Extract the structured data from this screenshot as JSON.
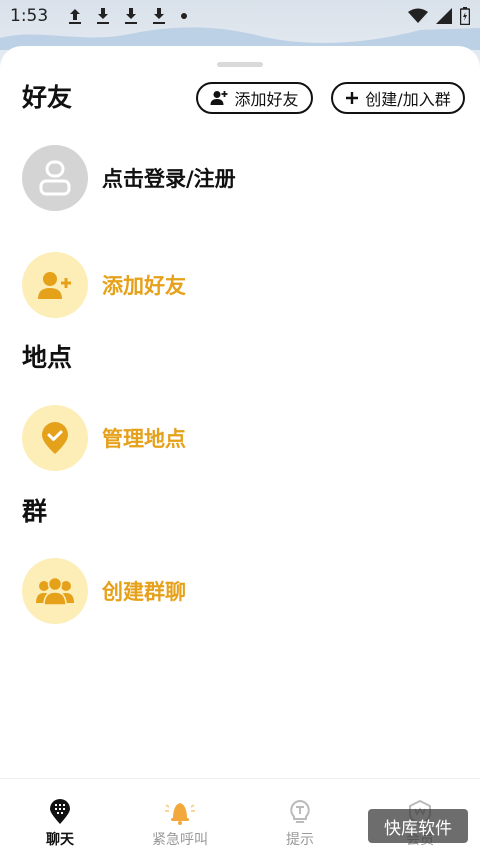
{
  "status_bar": {
    "time": "1:53"
  },
  "friends": {
    "title": "好友",
    "add_friend_button": "添加好友",
    "create_group_button": "创建/加入群",
    "login_label": "点击登录/注册",
    "add_friend_row_label": "添加好友"
  },
  "places": {
    "title": "地点",
    "manage_label": "管理地点"
  },
  "groups": {
    "title": "群",
    "create_label": "创建群聊"
  },
  "tabbar": {
    "tabs": [
      {
        "label": "聊天",
        "icon": "chat-grid-icon",
        "active": true
      },
      {
        "label": "紧急呼叫",
        "icon": "bell-icon",
        "active": false
      },
      {
        "label": "提示",
        "icon": "lightbulb-icon",
        "active": false
      },
      {
        "label": "会员",
        "icon": "vip-badge-icon",
        "active": false
      }
    ]
  },
  "watermark": "快库软件",
  "colors": {
    "accent_gold": "#e6a11b",
    "accent_yellow_bg": "#fdeeb8",
    "avatar_gray": "#d4d4d4"
  }
}
